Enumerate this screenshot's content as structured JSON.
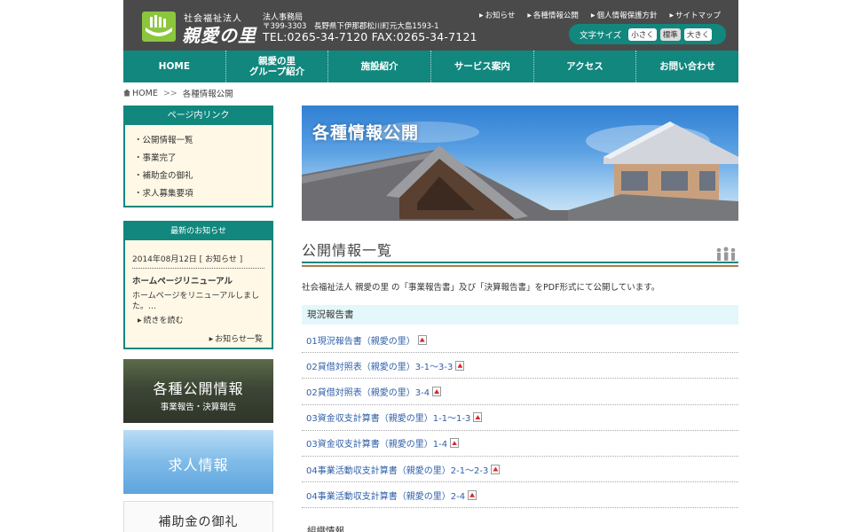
{
  "header": {
    "logo_small": "社会福祉法人",
    "logo_big": "親愛の里",
    "office_label": "法人事務局",
    "office_address": "〒399-3303　長野県下伊那郡松川町元大島1593-1",
    "office_tel": "TEL:0265-34-7120 FAX:0265-34-7121",
    "top_links": [
      "お知らせ",
      "各種情報公開",
      "個人情報保護方針",
      "サイトマップ"
    ],
    "font_size": {
      "label": "文字サイズ",
      "small": "小さく",
      "normal": "標準",
      "large": "大きく"
    }
  },
  "nav": {
    "items": [
      "HOME",
      "親愛の里\nグループ紹介",
      "施設紹介",
      "サービス案内",
      "アクセス",
      "お問い合わせ"
    ]
  },
  "breadcrumb": {
    "home": "HOME",
    "sep": ">>",
    "current": "各種情報公開"
  },
  "sidebar": {
    "page_links": {
      "title": "ページ内リンク",
      "items": [
        "・公開情報一覧",
        "・事業完了",
        "・補助金の御礼",
        "・求人募集要項"
      ]
    },
    "news": {
      "title": "最新のお知らせ",
      "date": "2014年08月12日 [ お知らせ ]",
      "headline": "ホームページリニューアル",
      "body": "ホームページをリニューアルしました。…",
      "more": "続きを読む",
      "all": "お知らせ一覧"
    },
    "banners": {
      "disclosure_main": "各種公開情報",
      "disclosure_sub": "事業報告・決算報告",
      "recruit": "求人情報",
      "grant": "補助金の御礼"
    }
  },
  "main": {
    "hero_title": "各種情報公開",
    "section_title": "公開情報一覧",
    "intro": "社会福祉法人 親愛の里 の「事業報告書」及び「決算報告書」をPDF形式にて公開しています。",
    "report_head": "現況報告書",
    "reports": [
      "01現況報告書（親愛の里）",
      "02貸借対照表（親愛の里）3-1〜3-3",
      "02貸借対照表（親愛の里）3-4",
      "03資金収支計算書（親愛の里）1-1〜1-3",
      "03資金収支計算書（親愛の里）1-4",
      "04事業活動収支計算書（親愛の里）2-1〜2-3",
      "04事業活動収支計算書（親愛の里）2-4"
    ],
    "org_head": "組織情報"
  },
  "colors": {
    "header_bg": "#4a4a4a",
    "accent_teal": "#11877e",
    "link_blue": "#2f5fa8",
    "logo_green": "#8cc63f",
    "sidebar_bg": "#fff8e6",
    "report_head_bg": "#e4f7fa"
  }
}
